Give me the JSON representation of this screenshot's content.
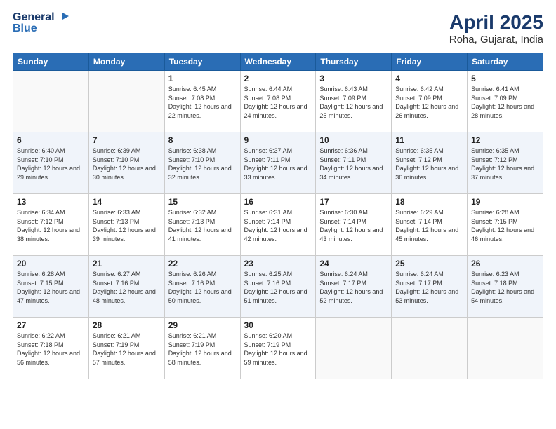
{
  "header": {
    "logo_line1": "General",
    "logo_line2": "Blue",
    "month": "April 2025",
    "location": "Roha, Gujarat, India"
  },
  "weekdays": [
    "Sunday",
    "Monday",
    "Tuesday",
    "Wednesday",
    "Thursday",
    "Friday",
    "Saturday"
  ],
  "weeks": [
    [
      {
        "day": "",
        "info": ""
      },
      {
        "day": "",
        "info": ""
      },
      {
        "day": "1",
        "info": "Sunrise: 6:45 AM\nSunset: 7:08 PM\nDaylight: 12 hours and 22 minutes."
      },
      {
        "day": "2",
        "info": "Sunrise: 6:44 AM\nSunset: 7:08 PM\nDaylight: 12 hours and 24 minutes."
      },
      {
        "day": "3",
        "info": "Sunrise: 6:43 AM\nSunset: 7:09 PM\nDaylight: 12 hours and 25 minutes."
      },
      {
        "day": "4",
        "info": "Sunrise: 6:42 AM\nSunset: 7:09 PM\nDaylight: 12 hours and 26 minutes."
      },
      {
        "day": "5",
        "info": "Sunrise: 6:41 AM\nSunset: 7:09 PM\nDaylight: 12 hours and 28 minutes."
      }
    ],
    [
      {
        "day": "6",
        "info": "Sunrise: 6:40 AM\nSunset: 7:10 PM\nDaylight: 12 hours and 29 minutes."
      },
      {
        "day": "7",
        "info": "Sunrise: 6:39 AM\nSunset: 7:10 PM\nDaylight: 12 hours and 30 minutes."
      },
      {
        "day": "8",
        "info": "Sunrise: 6:38 AM\nSunset: 7:10 PM\nDaylight: 12 hours and 32 minutes."
      },
      {
        "day": "9",
        "info": "Sunrise: 6:37 AM\nSunset: 7:11 PM\nDaylight: 12 hours and 33 minutes."
      },
      {
        "day": "10",
        "info": "Sunrise: 6:36 AM\nSunset: 7:11 PM\nDaylight: 12 hours and 34 minutes."
      },
      {
        "day": "11",
        "info": "Sunrise: 6:35 AM\nSunset: 7:12 PM\nDaylight: 12 hours and 36 minutes."
      },
      {
        "day": "12",
        "info": "Sunrise: 6:35 AM\nSunset: 7:12 PM\nDaylight: 12 hours and 37 minutes."
      }
    ],
    [
      {
        "day": "13",
        "info": "Sunrise: 6:34 AM\nSunset: 7:12 PM\nDaylight: 12 hours and 38 minutes."
      },
      {
        "day": "14",
        "info": "Sunrise: 6:33 AM\nSunset: 7:13 PM\nDaylight: 12 hours and 39 minutes."
      },
      {
        "day": "15",
        "info": "Sunrise: 6:32 AM\nSunset: 7:13 PM\nDaylight: 12 hours and 41 minutes."
      },
      {
        "day": "16",
        "info": "Sunrise: 6:31 AM\nSunset: 7:14 PM\nDaylight: 12 hours and 42 minutes."
      },
      {
        "day": "17",
        "info": "Sunrise: 6:30 AM\nSunset: 7:14 PM\nDaylight: 12 hours and 43 minutes."
      },
      {
        "day": "18",
        "info": "Sunrise: 6:29 AM\nSunset: 7:14 PM\nDaylight: 12 hours and 45 minutes."
      },
      {
        "day": "19",
        "info": "Sunrise: 6:28 AM\nSunset: 7:15 PM\nDaylight: 12 hours and 46 minutes."
      }
    ],
    [
      {
        "day": "20",
        "info": "Sunrise: 6:28 AM\nSunset: 7:15 PM\nDaylight: 12 hours and 47 minutes."
      },
      {
        "day": "21",
        "info": "Sunrise: 6:27 AM\nSunset: 7:16 PM\nDaylight: 12 hours and 48 minutes."
      },
      {
        "day": "22",
        "info": "Sunrise: 6:26 AM\nSunset: 7:16 PM\nDaylight: 12 hours and 50 minutes."
      },
      {
        "day": "23",
        "info": "Sunrise: 6:25 AM\nSunset: 7:16 PM\nDaylight: 12 hours and 51 minutes."
      },
      {
        "day": "24",
        "info": "Sunrise: 6:24 AM\nSunset: 7:17 PM\nDaylight: 12 hours and 52 minutes."
      },
      {
        "day": "25",
        "info": "Sunrise: 6:24 AM\nSunset: 7:17 PM\nDaylight: 12 hours and 53 minutes."
      },
      {
        "day": "26",
        "info": "Sunrise: 6:23 AM\nSunset: 7:18 PM\nDaylight: 12 hours and 54 minutes."
      }
    ],
    [
      {
        "day": "27",
        "info": "Sunrise: 6:22 AM\nSunset: 7:18 PM\nDaylight: 12 hours and 56 minutes."
      },
      {
        "day": "28",
        "info": "Sunrise: 6:21 AM\nSunset: 7:19 PM\nDaylight: 12 hours and 57 minutes."
      },
      {
        "day": "29",
        "info": "Sunrise: 6:21 AM\nSunset: 7:19 PM\nDaylight: 12 hours and 58 minutes."
      },
      {
        "day": "30",
        "info": "Sunrise: 6:20 AM\nSunset: 7:19 PM\nDaylight: 12 hours and 59 minutes."
      },
      {
        "day": "",
        "info": ""
      },
      {
        "day": "",
        "info": ""
      },
      {
        "day": "",
        "info": ""
      }
    ]
  ]
}
